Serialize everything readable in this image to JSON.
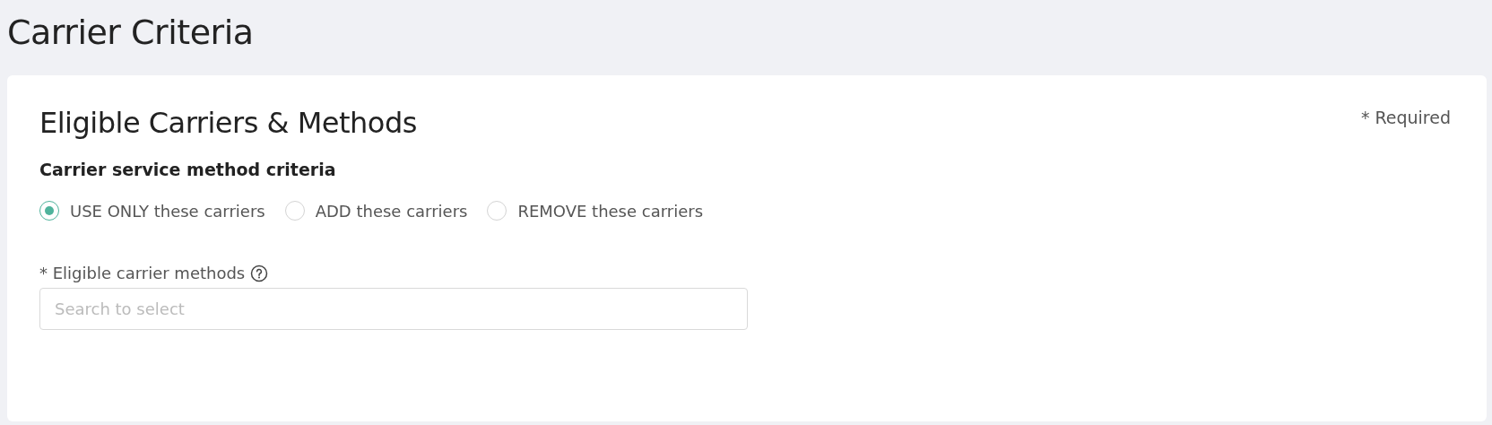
{
  "page": {
    "title": "Carrier Criteria"
  },
  "card": {
    "title": "Eligible Carriers & Methods",
    "required_note": "* Required",
    "subtitle": "Carrier service method criteria",
    "options": [
      {
        "label": "USE ONLY these carriers",
        "selected": true
      },
      {
        "label": "ADD these carriers",
        "selected": false
      },
      {
        "label": "REMOVE these carriers",
        "selected": false
      }
    ],
    "field": {
      "label": "* Eligible carrier methods",
      "placeholder": "Search to select"
    }
  }
}
